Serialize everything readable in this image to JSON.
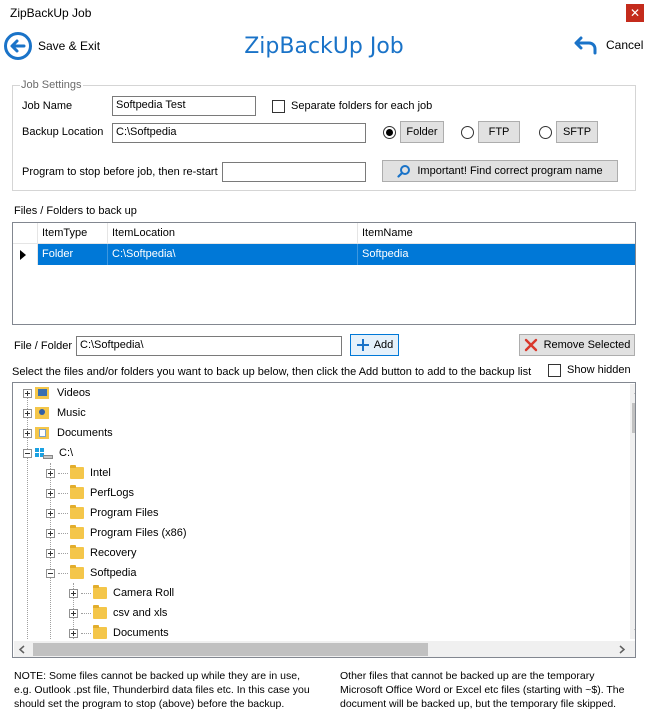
{
  "window": {
    "title": "ZipBackUp Job",
    "close_glyph": "✕"
  },
  "header": {
    "title": "ZipBackUp Job",
    "save_exit_label": "Save & Exit",
    "cancel_label": "Cancel"
  },
  "job_settings": {
    "legend": "Job Settings",
    "job_name_label": "Job Name",
    "job_name_value": "Softpedia Test",
    "separate_folders_label": "Separate folders for each job",
    "backup_location_label": "Backup Location",
    "backup_location_value": "C:\\Softpedia",
    "protocol_options": [
      "Folder",
      "FTP",
      "SFTP"
    ],
    "selected_protocol": "Folder",
    "program_stop_label": "Program to stop before job, then re-start",
    "program_stop_value": "",
    "find_program_button": "Important! Find correct program name"
  },
  "files_section": {
    "label": "Files / Folders to back up",
    "columns": [
      "ItemType",
      "ItemLocation",
      "ItemName"
    ],
    "rows": [
      [
        "Folder",
        "C:\\Softpedia\\",
        "Softpedia"
      ]
    ]
  },
  "file_folder": {
    "label": "File / Folder",
    "value": "C:\\Softpedia\\",
    "add_button": "Add",
    "remove_button": "Remove Selected"
  },
  "instructions": "Select the files and/or folders you want to back up below, then click the Add button to add to the backup list",
  "show_hidden_label": "Show hidden",
  "tree": {
    "nodes": [
      "Videos",
      "Music",
      "Documents",
      "C:\\",
      "Intel",
      "PerfLogs",
      "Program Files",
      "Program Files (x86)",
      "Recovery",
      "Softpedia",
      "Camera Roll",
      "csv and xls",
      "Documents"
    ]
  },
  "notes": {
    "left": "NOTE: Some files cannot be backed up while they are in use, e.g. Outlook .pst file, Thunderbird data files etc. In this case you should set the program to stop (above) before the backup.",
    "right": "Other files that cannot be backed up are the temporary Microsoft Office Word or Excel etc files (starting with ~$). The document will be backed up, but the temporary file skipped."
  },
  "colors": {
    "accent": "#1a73c8",
    "selection": "#0078d7",
    "close": "#c42b1c",
    "remove_x": "#d9372b"
  }
}
